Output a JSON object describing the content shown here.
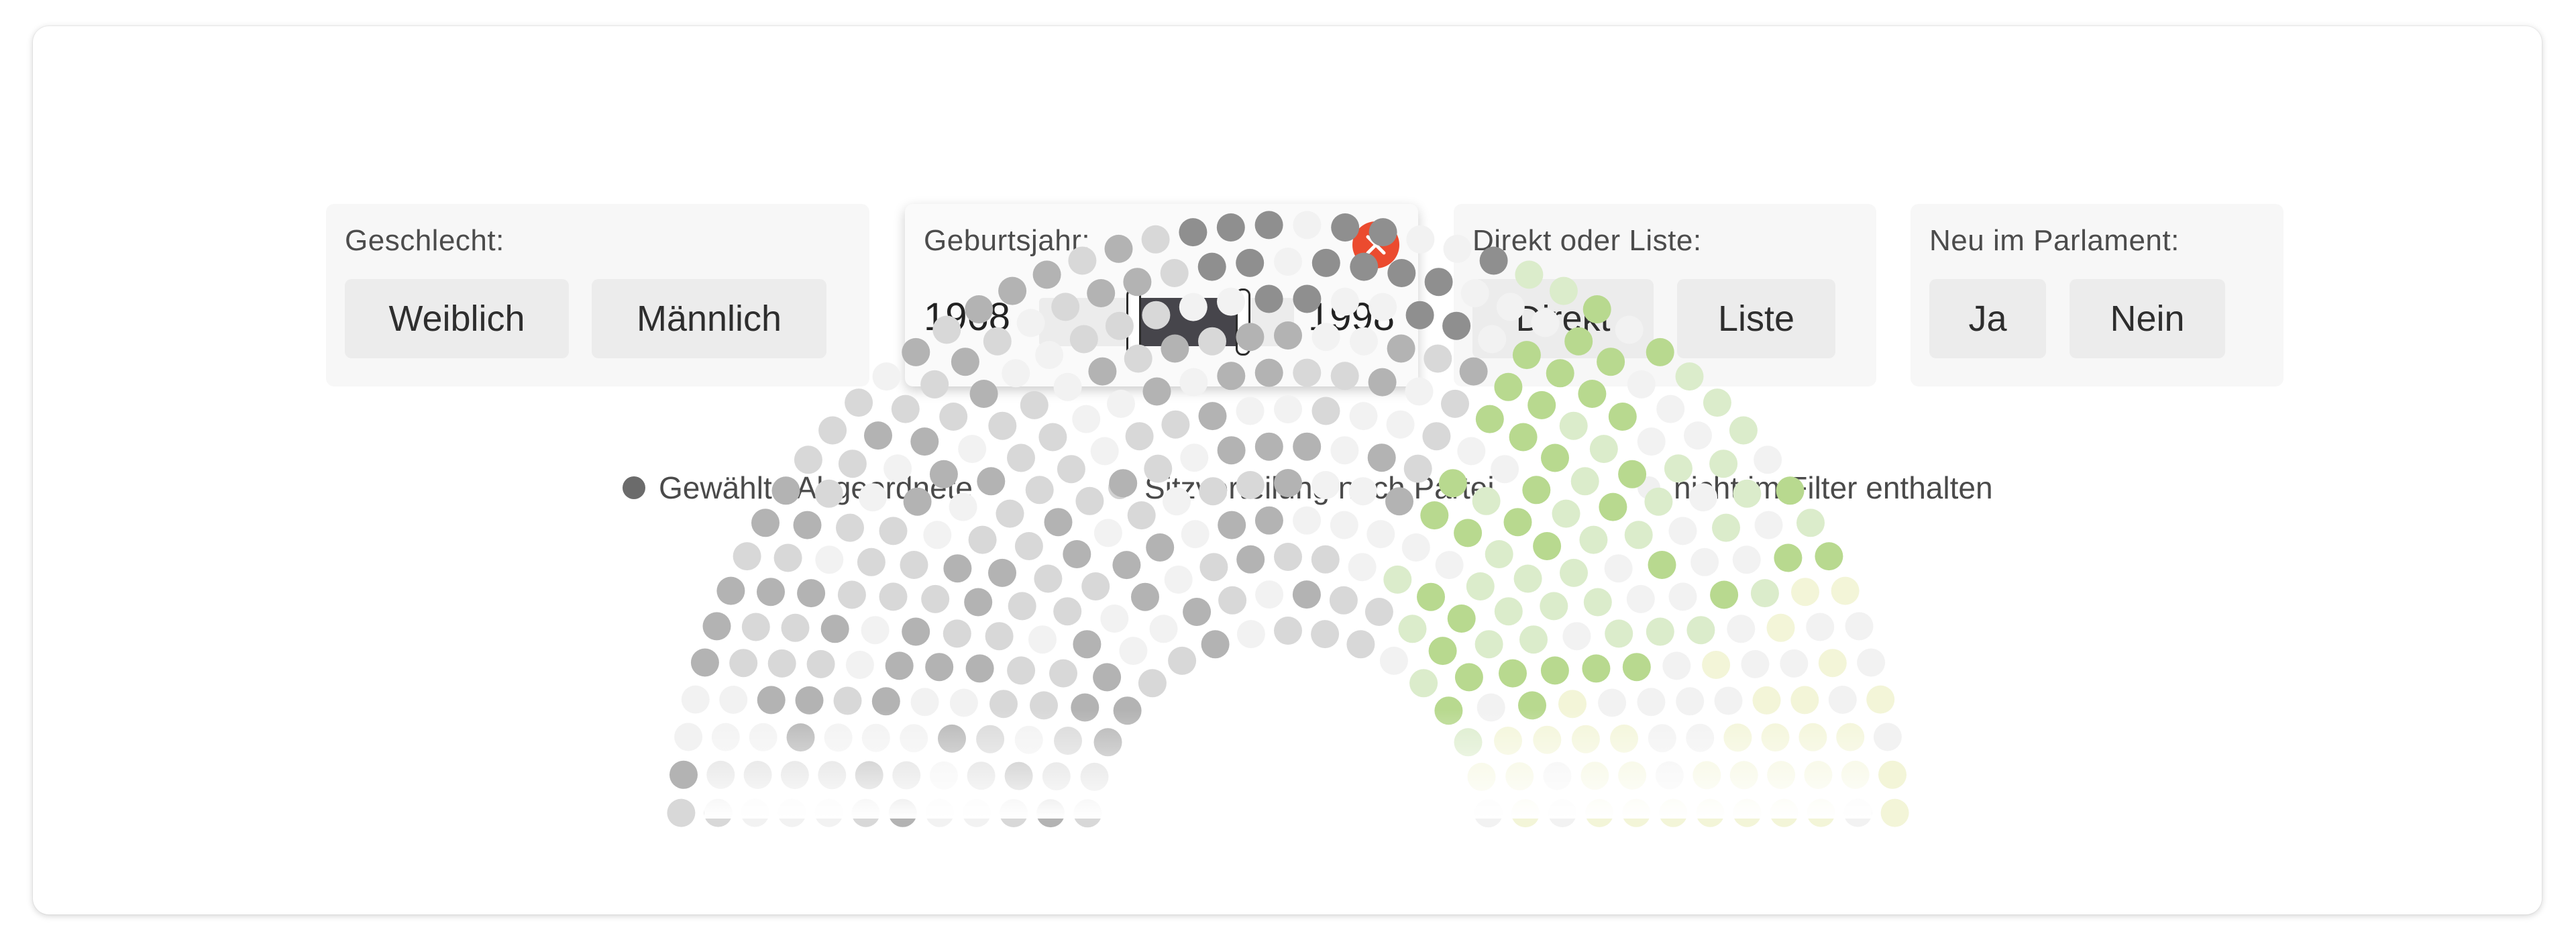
{
  "filters": {
    "gender": {
      "label": "Geschlecht:",
      "options": [
        "Weiblich",
        "Männlich"
      ]
    },
    "birth_year": {
      "label": "Geburtsjahr:",
      "from": "1968",
      "to": "1998",
      "clear_icon": "close-icon",
      "range_fraction": [
        0.37,
        0.8
      ]
    },
    "mandate": {
      "label": "Direkt oder Liste:",
      "options": [
        "Direkt",
        "Liste"
      ]
    },
    "new_member": {
      "label": "Neu im Parlament:",
      "options": [
        "Ja",
        "Nein"
      ]
    }
  },
  "legend": {
    "items": [
      {
        "label": "Gewählte Abgeordnete",
        "color": "#6b6b6b"
      },
      {
        "label": "Sitzverteilung nach Partei",
        "color": "#d2d2d2"
      },
      {
        "label": "nicht im Filter enthalten",
        "color": "#f0f0f0"
      }
    ]
  },
  "colors": {
    "accent_close": "#eb4b2f",
    "selected_dark": "#8f8f8f",
    "selected_gray": "#b3b3b3",
    "party_gray": "#d8d8d8",
    "excluded": "#f2f2f2",
    "green_selected": "#b8d98f",
    "green_party": "#dbeccb",
    "yellow_party": "#f3f5d8"
  }
}
